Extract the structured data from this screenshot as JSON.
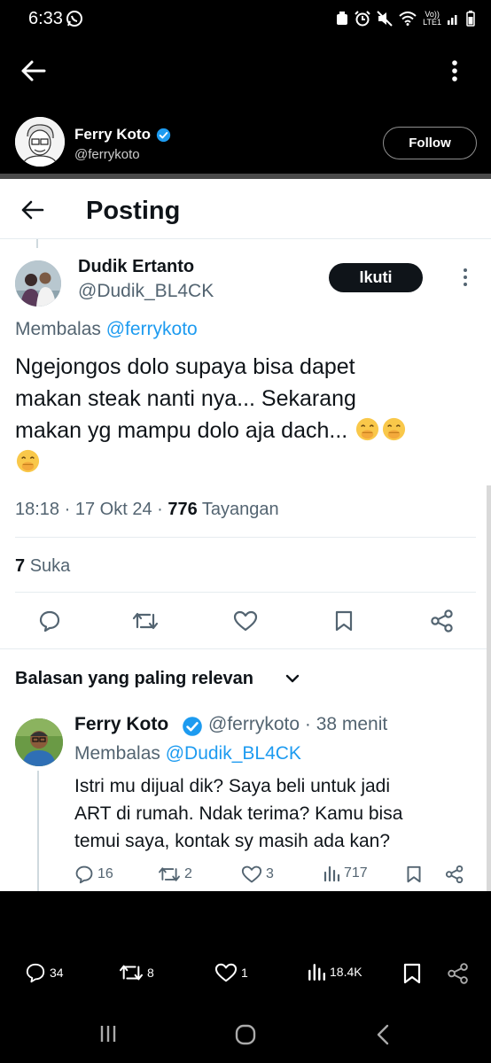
{
  "status_bar": {
    "time": "6:33",
    "network_top": "Vo))",
    "network_bottom": "LTE1"
  },
  "profile": {
    "name": "Ferry Koto",
    "handle": "@ferrykoto",
    "follow_label": "Follow"
  },
  "embedded": {
    "header_title": "Posting",
    "post": {
      "author_name": "Dudik Ertanto",
      "author_handle": "@Dudik_BL4CK",
      "follow_label": "Ikuti",
      "replying_prefix": "Membalas",
      "replying_to": "@ferrykoto",
      "text_line1": "Ngejongos dolo supaya bisa dapet",
      "text_line2": "makan steak nanti nya... Sekarang",
      "text_line3": "makan yg mampu dolo aja dach...",
      "time": "18:18",
      "date": "17 Okt 24",
      "views": "776",
      "views_label": "Tayangan",
      "likes": "7",
      "likes_label": "Suka"
    },
    "replies_sort_label": "Balasan yang paling relevan",
    "reply": {
      "author_name": "Ferry Koto",
      "author_handle": "@ferrykoto",
      "age": "38 menit",
      "replying_prefix": "Membalas",
      "replying_to": "@Dudik_BL4CK",
      "text_line1": "Istri mu dijual dik? Saya beli untuk jadi",
      "text_line2": "ART di rumah. Ndak terima? Kamu bisa",
      "text_line3": "temui saya, kontak sy masih ada kan?",
      "replies": "16",
      "reposts": "2",
      "likes": "3",
      "views": "717"
    }
  },
  "bottom_actions": {
    "replies": "34",
    "reposts": "8",
    "likes": "1",
    "views": "18.4K"
  },
  "colors": {
    "accent": "#1d9bf0",
    "text": "#0f1419",
    "muted": "#536471",
    "divider": "#e6ecf0",
    "verified": "#1d9bf0"
  },
  "icons": [
    "whatsapp-icon",
    "back-arrow-icon",
    "more-vertical-icon",
    "verified-icon",
    "reply-icon",
    "repost-icon",
    "like-icon",
    "bookmark-icon",
    "share-icon",
    "views-icon",
    "chevron-down-icon",
    "face-with-hand-over-mouth-emoji"
  ]
}
